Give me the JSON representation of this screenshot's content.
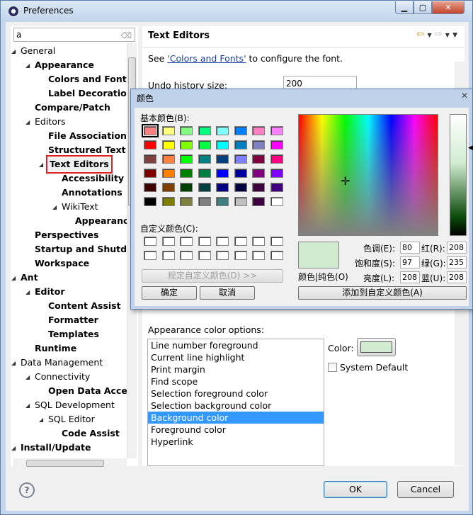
{
  "window": {
    "title": "Preferences"
  },
  "filter": {
    "value": "a"
  },
  "tree": [
    {
      "label": "General",
      "level": 0,
      "expanded": true,
      "bold": false
    },
    {
      "label": "Appearance",
      "level": 1,
      "expanded": true,
      "bold": true
    },
    {
      "label": "Colors and Fonts",
      "level": 2,
      "bold": true
    },
    {
      "label": "Label Decorations",
      "level": 2,
      "bold": true
    },
    {
      "label": "Compare/Patch",
      "level": 1,
      "bold": true
    },
    {
      "label": "Editors",
      "level": 1,
      "expanded": true,
      "bold": false
    },
    {
      "label": "File Associations",
      "level": 2,
      "bold": true
    },
    {
      "label": "Structured Text Editors",
      "level": 2,
      "bold": true
    },
    {
      "label": "Text Editors",
      "level": 2,
      "expanded": true,
      "bold": true,
      "selected": true
    },
    {
      "label": "Accessibility",
      "level": 3,
      "bold": true
    },
    {
      "label": "Annotations",
      "level": 3,
      "bold": true
    },
    {
      "label": "WikiText",
      "level": 3,
      "expanded": true,
      "bold": false
    },
    {
      "label": "Appearance",
      "level": 4,
      "bold": true
    },
    {
      "label": "Perspectives",
      "level": 1,
      "bold": true
    },
    {
      "label": "Startup and Shutdown",
      "level": 1,
      "bold": true
    },
    {
      "label": "Workspace",
      "level": 1,
      "bold": true
    },
    {
      "label": "Ant",
      "level": 0,
      "expanded": true,
      "bold": true
    },
    {
      "label": "Editor",
      "level": 1,
      "expanded": true,
      "bold": true
    },
    {
      "label": "Content Assist",
      "level": 2,
      "bold": true
    },
    {
      "label": "Formatter",
      "level": 2,
      "bold": true
    },
    {
      "label": "Templates",
      "level": 2,
      "bold": true
    },
    {
      "label": "Runtime",
      "level": 1,
      "bold": true
    },
    {
      "label": "Data Management",
      "level": 0,
      "expanded": true,
      "bold": false
    },
    {
      "label": "Connectivity",
      "level": 1,
      "expanded": true,
      "bold": false
    },
    {
      "label": "Open Data Access",
      "level": 2,
      "bold": true
    },
    {
      "label": "SQL Development",
      "level": 1,
      "expanded": true,
      "bold": false
    },
    {
      "label": "SQL Editor",
      "level": 2,
      "expanded": true,
      "bold": false
    },
    {
      "label": "Code Assist",
      "level": 3,
      "bold": true
    },
    {
      "label": "Install/Update",
      "level": 0,
      "expanded": true,
      "bold": true
    }
  ],
  "page": {
    "title": "Text Editors",
    "see_prefix": "See ",
    "see_link": "'Colors and Fonts'",
    "see_suffix": " to configure the font.",
    "undo_label": "Undo history size:",
    "undo_value": "200",
    "appearance_label": "Appearance color options:",
    "options": [
      "Line number foreground",
      "Current line highlight",
      "Print margin",
      "Find scope",
      "Selection foreground color",
      "Selection background color",
      "Background color",
      "Foreground color",
      "Hyperlink"
    ],
    "selected_option": 6,
    "color_label": "Color:",
    "color_value": "#d0ebd0",
    "system_default": "System Default"
  },
  "buttons": {
    "ok": "OK",
    "cancel": "Cancel"
  },
  "icons": {
    "help": "help-icon",
    "back": "back-arrow-icon",
    "forward": "forward-arrow-icon",
    "menu": "view-menu-icon"
  },
  "dialog": {
    "title": "颜色",
    "basic_label": "基本颜色(B):",
    "custom_label": "自定义颜色(C):",
    "define_custom": "规定自定义颜色(D) >>",
    "ok": "确定",
    "cancel": "取消",
    "color_solid": "颜色|纯色(O)",
    "add_custom": "添加到自定义颜色(A)",
    "hue_label": "色调(E):",
    "hue": "80",
    "sat_label": "饱和度(S):",
    "sat": "97",
    "lum_label": "亮度(L):",
    "lum": "208",
    "red_label": "红(R):",
    "red": "208",
    "green_label": "绿(G):",
    "green": "235",
    "blue_label": "蓝(U):",
    "blue": "208",
    "basic_colors": [
      "#ff8080",
      "#ffff80",
      "#80ff80",
      "#00ff80",
      "#80ffff",
      "#0080ff",
      "#ff80c0",
      "#ff80ff",
      "#ff0000",
      "#ffff00",
      "#80ff00",
      "#00ff40",
      "#00ffff",
      "#0080c0",
      "#8080c0",
      "#ff00ff",
      "#804040",
      "#ff8040",
      "#00ff00",
      "#008080",
      "#004080",
      "#8080ff",
      "#800040",
      "#ff0080",
      "#800000",
      "#ff8000",
      "#008000",
      "#008040",
      "#0000ff",
      "#0000a0",
      "#800080",
      "#8000ff",
      "#400000",
      "#804000",
      "#004000",
      "#004040",
      "#000080",
      "#000040",
      "#400040",
      "#400080",
      "#000000",
      "#808000",
      "#808040",
      "#808080",
      "#408080",
      "#c0c0c0",
      "#400040",
      "#ffffff"
    ]
  }
}
